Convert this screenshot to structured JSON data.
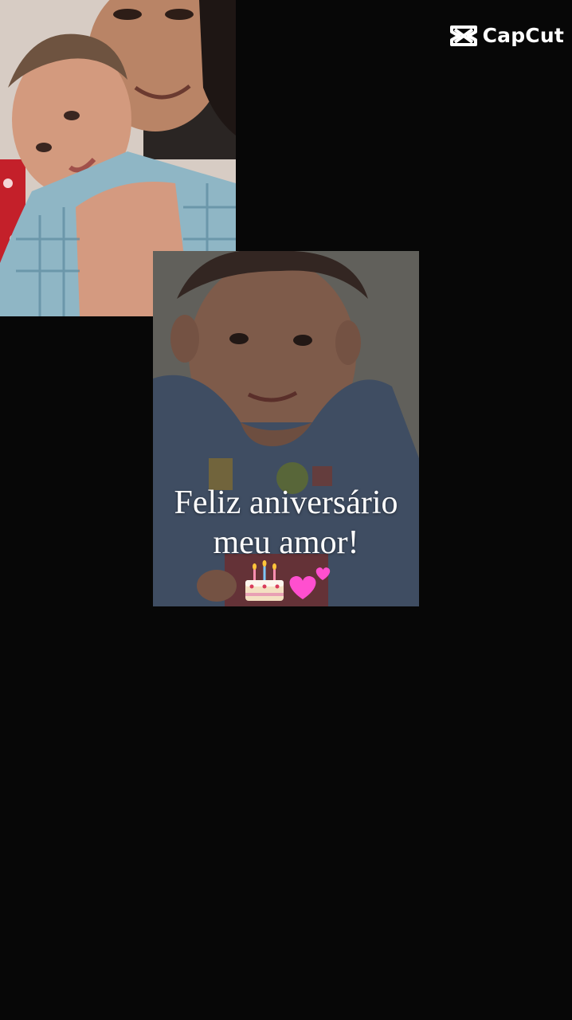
{
  "watermark": {
    "brand": "CapCut",
    "icon": "capcut-logo-icon"
  },
  "photos": [
    {
      "id": "selfie-collage-photo",
      "description_icon": "photo"
    },
    {
      "id": "birthday-boy-photo",
      "description_icon": "photo"
    }
  ],
  "caption": {
    "line1": "Feliz aniversário",
    "line2": "meu amor!",
    "emojis": [
      "birthday-cake-emoji",
      "two-hearts-emoji"
    ]
  },
  "colors": {
    "background": "#070707",
    "text": "#ffffff",
    "heart": "#ff4fcf"
  }
}
